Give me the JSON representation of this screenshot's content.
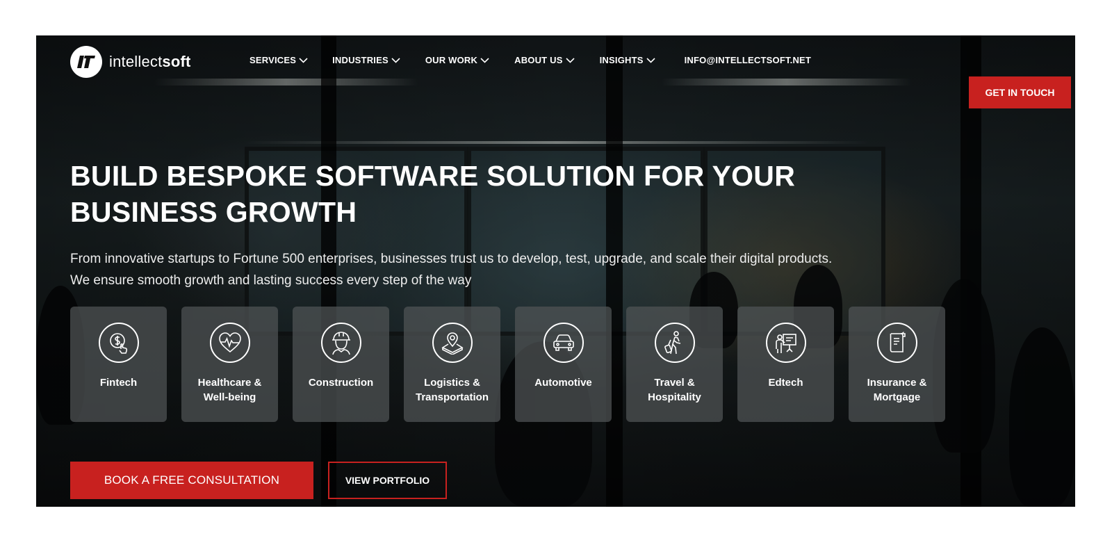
{
  "brand": {
    "name_light": "intellect",
    "name_bold": "soft"
  },
  "nav": {
    "items": [
      {
        "label": "SERVICES"
      },
      {
        "label": "INDUSTRIES"
      },
      {
        "label": "OUR WORK"
      },
      {
        "label": "ABOUT US"
      },
      {
        "label": "INSIGHTS"
      }
    ],
    "email": "INFO@INTELLECTSOFT.NET"
  },
  "header_cta": "GET IN TOUCH",
  "hero": {
    "title": "BUILD BESPOKE SOFTWARE SOLUTION FOR YOUR BUSINESS GROWTH",
    "subtitle_line1": "From innovative startups to Fortune 500 enterprises, businesses trust us to develop, test, upgrade, and scale their digital products.",
    "subtitle_line2": "We ensure smooth growth and lasting success every step of the way"
  },
  "industries": [
    {
      "label": "Fintech",
      "icon": "fintech-icon"
    },
    {
      "label": "Healthcare & Well-being",
      "icon": "heart-pulse-icon"
    },
    {
      "label": "Construction",
      "icon": "hard-hat-worker-icon"
    },
    {
      "label": "Logistics & Transportation",
      "icon": "map-pin-icon"
    },
    {
      "label": "Automotive",
      "icon": "car-icon"
    },
    {
      "label": "Travel & Hospitality",
      "icon": "traveler-icon"
    },
    {
      "label": "Edtech",
      "icon": "presenter-board-icon"
    },
    {
      "label": "Insurance & Mortgage",
      "icon": "document-icon"
    }
  ],
  "actions": {
    "primary": "BOOK A FREE CONSULTATION",
    "secondary": "VIEW PORTFOLIO"
  },
  "colors": {
    "accent": "#c8211f",
    "text": "#ffffff"
  }
}
